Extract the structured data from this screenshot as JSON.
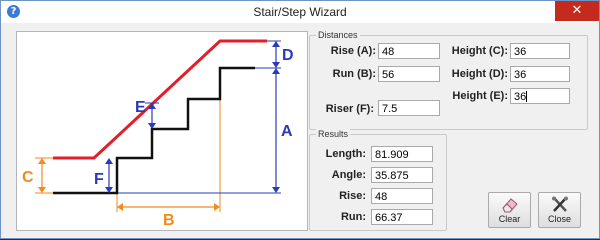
{
  "window": {
    "title": "Stair/Step Wizard",
    "help_icon_glyph": "?",
    "close_glyph": "✕"
  },
  "diagram": {
    "label_A": "A",
    "label_B": "B",
    "label_C": "C",
    "label_D": "D",
    "label_E": "E",
    "label_F": "F"
  },
  "distances": {
    "title": "Distances",
    "rise_label": "Rise (A):",
    "rise_value": "48",
    "run_label": "Run (B):",
    "run_value": "56",
    "riser_label": "Riser (F):",
    "riser_value": "7.5",
    "height_c_label": "Height (C):",
    "height_c_value": "36",
    "height_d_label": "Height (D):",
    "height_d_value": "36",
    "height_e_label": "Height (E):",
    "height_e_value": "36"
  },
  "results": {
    "title": "Results",
    "length_label": "Length:",
    "length_value": "81.909",
    "angle_label": "Angle:",
    "angle_value": "35.875",
    "rise_label": "Rise:",
    "rise_value": "48",
    "run_label": "Run:",
    "run_value": "66.37"
  },
  "buttons": {
    "clear_label": "Clear",
    "close_label": "Close"
  },
  "colors": {
    "red_line": "#e0202a",
    "blue_dim": "#2b3bb8",
    "orange_dim": "#f28a1e",
    "close_button": "#c42b1c"
  }
}
